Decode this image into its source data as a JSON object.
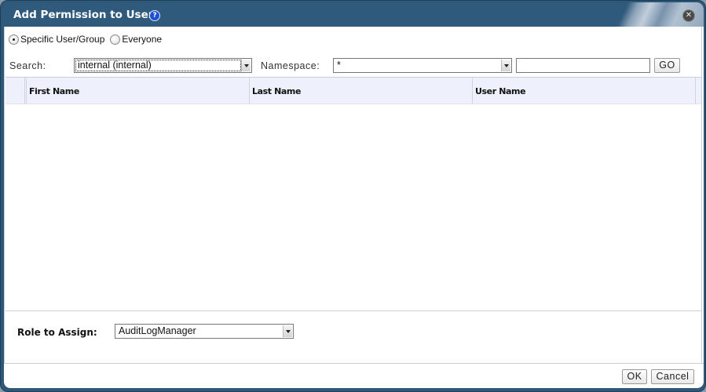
{
  "dialog": {
    "title": "Add Permission to User",
    "help_icon": "?",
    "close_icon": "✕"
  },
  "scope": {
    "options": [
      {
        "label": "Specific User/Group",
        "checked": true
      },
      {
        "label": "Everyone",
        "checked": false
      }
    ]
  },
  "search": {
    "label": "Search:",
    "domain_value": "internal (internal)",
    "namespace_label": "Namespace:",
    "namespace_value": "*",
    "query_value": "",
    "go_label": "GO"
  },
  "table": {
    "columns": [
      "First Name",
      "Last Name",
      "User Name"
    ],
    "rows": []
  },
  "role": {
    "label": "Role to Assign:",
    "value": "AuditLogManager"
  },
  "footer": {
    "ok_label": "OK",
    "cancel_label": "Cancel"
  }
}
